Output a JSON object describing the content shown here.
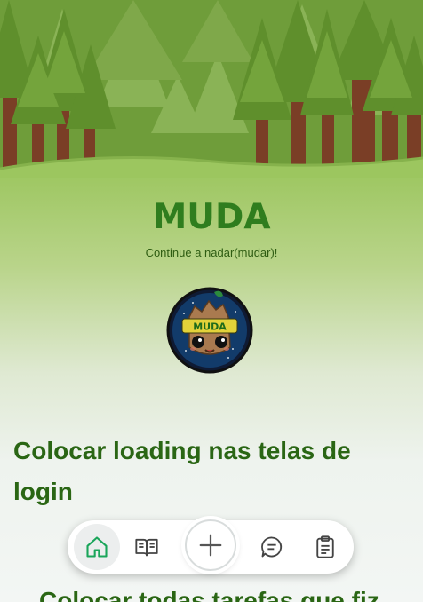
{
  "app": {
    "title": "MUDA",
    "tagline": "Continue a nadar(mudar)!",
    "avatar_badge": "MUDA"
  },
  "tasks": [
    {
      "title": "Colocar loading nas telas de login"
    },
    {
      "title": "Colocar todas tarefas que fiz"
    }
  ],
  "nav": {
    "items": [
      {
        "name": "home",
        "icon": "home-icon",
        "active": true
      },
      {
        "name": "journal",
        "icon": "book-icon",
        "active": false
      },
      {
        "name": "add",
        "icon": "plus-icon",
        "active": false
      },
      {
        "name": "messages",
        "icon": "chat-icon",
        "active": false
      },
      {
        "name": "tasks",
        "icon": "clipboard-icon",
        "active": false
      }
    ]
  },
  "colors": {
    "brand": "#2f7d1e",
    "forest_light": "#9cc65f",
    "nav_active": "#1aa55a"
  }
}
